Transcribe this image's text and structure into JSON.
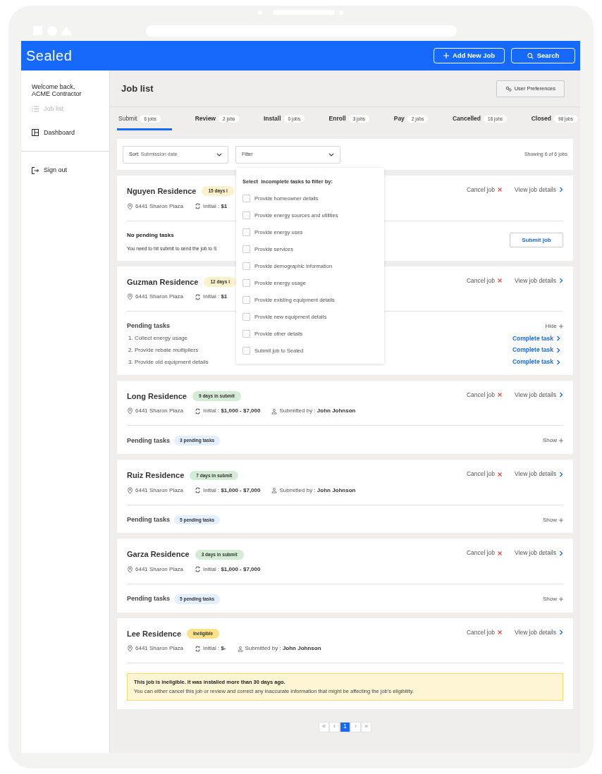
{
  "header": {
    "logo": "Sealed",
    "buttons": [
      {
        "kind": "add",
        "label": "Add New Job"
      },
      {
        "kind": "search",
        "label": "Search"
      }
    ]
  },
  "sidebar": {
    "welcome": "Welcome back,\nACME Contractor",
    "items": [
      {
        "kind": "list",
        "label": "Job list",
        "selected": true
      },
      {
        "kind": "dashboard",
        "label": "Dashboard",
        "selected": false
      }
    ],
    "sign_out": "Sign out"
  },
  "page_title": "Job list",
  "preferences_button": "User Preferences",
  "tabs": [
    {
      "label": "Submit",
      "count": "6 jobs",
      "selected": true
    },
    {
      "label": "Review",
      "count": "2 jobs",
      "selected": false
    },
    {
      "label": "Install",
      "count": "0 jobs",
      "selected": false
    },
    {
      "label": "Enroll",
      "count": "3 jobs",
      "selected": false
    },
    {
      "label": "Pay",
      "count": "2 jobs",
      "selected": false
    },
    {
      "label": "Cancelled",
      "count": "16 jobs",
      "selected": false
    },
    {
      "label": "Closed",
      "count": "98 jobs",
      "selected": false
    }
  ],
  "toolbar": {
    "sort_label": "Sort:",
    "sort_value": "Submission date",
    "filter": "Filter",
    "showing": "Showing 6 of 6 jobs"
  },
  "filter_menu": {
    "title": "Select  incomplete tasks to filter by:",
    "options": [
      {
        "label": "Provide homeowner details",
        "checked": false
      },
      {
        "label": "Provide energy sources and utilities",
        "checked": false
      },
      {
        "label": "Provide energy uses",
        "checked": false
      },
      {
        "label": "Provide services",
        "checked": false
      },
      {
        "label": "Provide demographic information",
        "checked": false
      },
      {
        "label": "Provide energy usage",
        "checked": false
      },
      {
        "label": "Provide existing equipment details",
        "checked": false
      },
      {
        "label": "Provide new equipment details",
        "checked": false
      },
      {
        "label": "Provide other details",
        "checked": false
      },
      {
        "label": "Submit job to Sealed",
        "checked": false
      }
    ]
  },
  "jobs": [
    {
      "name": "Nguyen Residence",
      "badge": {
        "text": "15 days i",
        "kind": "warning"
      },
      "address": "6441 Sharon Plaza",
      "initial_label": "Initial :",
      "initial": "$1",
      "cancel": "Cancel job",
      "details": "View job details",
      "kind": "no_pending",
      "section_title": "No pending tasks",
      "note": "You need to hit submit to send the job to S",
      "action": "Submit job"
    },
    {
      "name": "Guzman Residence",
      "badge": {
        "text": "12 days i",
        "kind": "warning"
      },
      "address": "6441 Sharon Plaza",
      "initial_label": "Initial :",
      "initial": "$1",
      "cancel": "Cancel job",
      "details": "View job details",
      "kind": "pending_open",
      "section_title": "Pending tasks",
      "toggle": "Hide",
      "tasks": [
        {
          "label": "1. Collect energy usage",
          "link": "Complete task"
        },
        {
          "label": "2. Provide rebate multipliers",
          "link": "Complete task"
        },
        {
          "label": "3. Provide old equipment details",
          "link": "Complete task"
        }
      ]
    },
    {
      "name": "Long Residence",
      "badge": {
        "text": "9 days in submit",
        "kind": "success"
      },
      "address": "6441 Sharon Plaza",
      "initial_label": "Initial :",
      "initial": "$1,000 - $7,000",
      "submitted_label": "Submitted by :",
      "submitted_by": "John Johnson",
      "cancel": "Cancel job",
      "details": "View job details",
      "kind": "pending_closed",
      "section_title": "Pending tasks",
      "count": "3 pending tasks",
      "toggle": "Show"
    },
    {
      "name": "Ruiz Residence",
      "badge": {
        "text": "7 days in submit",
        "kind": "success"
      },
      "address": "6441 Sharon Plaza",
      "initial_label": "Initial :",
      "initial": "$1,000 - $7,000",
      "submitted_label": "Submitted by :",
      "submitted_by": "John Johnson",
      "cancel": "Cancel job",
      "details": "View job details",
      "kind": "pending_closed",
      "section_title": "Pending tasks",
      "count": "5 pending tasks",
      "toggle": "Show"
    },
    {
      "name": "Garza Residence",
      "badge": {
        "text": "3 days in submit",
        "kind": "success"
      },
      "address": "6441 Sharon Plaza",
      "initial_label": "Initial :",
      "initial": "$1,000 - $7,000",
      "cancel": "Cancel job",
      "details": "View job details",
      "kind": "pending_closed",
      "section_title": "Pending tasks",
      "count": "5 pending tasks",
      "toggle": "Show"
    },
    {
      "name": "Lee Residence",
      "badge": {
        "text": "Ineligible",
        "kind": "ineligible"
      },
      "address": "6441 Sharon Plaza",
      "initial_label": "Initial :",
      "initial": "$-",
      "submitted_label": "Submitted by :",
      "submitted_by": "John Johnson",
      "cancel": "Cancel job",
      "details": "View job details",
      "kind": "ineligible",
      "alert_title": "This job is ineligible. It was installed more than 30 days ago.",
      "alert_text": "You can either cancel this job or review and correct any inaccurate information that might be affecting the job’s eligibility."
    }
  ],
  "pagination": [
    {
      "label": "«",
      "selected": false
    },
    {
      "label": "‹",
      "selected": false
    },
    {
      "label": "1",
      "selected": true
    },
    {
      "label": "›",
      "selected": false
    },
    {
      "label": "»",
      "selected": false
    }
  ]
}
